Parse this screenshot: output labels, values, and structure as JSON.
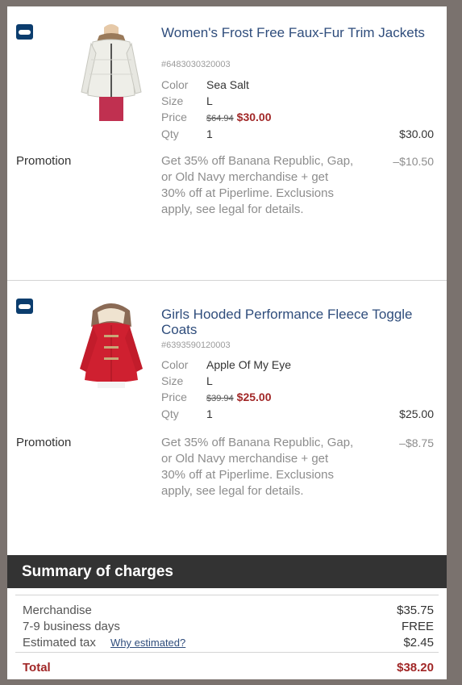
{
  "items": [
    {
      "title": "Women's Frost Free Faux-Fur Trim Jackets",
      "sku": "#6483030320003",
      "color_label": "Color",
      "color": "Sea Salt",
      "size_label": "Size",
      "size": "L",
      "price_label": "Price",
      "original_price": "$64.94",
      "sale_price": "$30.00",
      "qty_label": "Qty",
      "qty": "1",
      "line_total": "$30.00",
      "promotion_label": "Promotion",
      "promotion_text": "Get 35% off Banana Republic, Gap, or Old Navy merchandise + get 30% off at Piperlime. Exclusions apply, see legal for details.",
      "promotion_amount": "–$10.50"
    },
    {
      "title": "Girls Hooded Performance Fleece Toggle Coats",
      "sku": "#6393590120003",
      "color_label": "Color",
      "color": "Apple Of My Eye",
      "size_label": "Size",
      "size": "L",
      "price_label": "Price",
      "original_price": "$39.94",
      "sale_price": "$25.00",
      "qty_label": "Qty",
      "qty": "1",
      "line_total": "$25.00",
      "promotion_label": "Promotion",
      "promotion_text": "Get 35% off Banana Republic, Gap, or Old Navy merchandise + get 30% off at Piperlime. Exclusions apply, see legal for details.",
      "promotion_amount": "–$8.75"
    }
  ],
  "summary": {
    "title": "Summary of charges",
    "merchandise_label": "Merchandise",
    "merchandise": "$35.75",
    "shipping_label": "7-9 business days",
    "shipping": "FREE",
    "tax_label": "Estimated tax",
    "tax_link": "Why estimated?",
    "tax": "$2.45",
    "total_label": "Total",
    "total": "$38.20"
  },
  "colors": {
    "title_blue": "#2f4d7c",
    "sale_red": "#a12727",
    "summary_bar": "#333333",
    "brand_navy": "#0b3d6e"
  },
  "icons": [
    "old-navy-brand-icon"
  ]
}
